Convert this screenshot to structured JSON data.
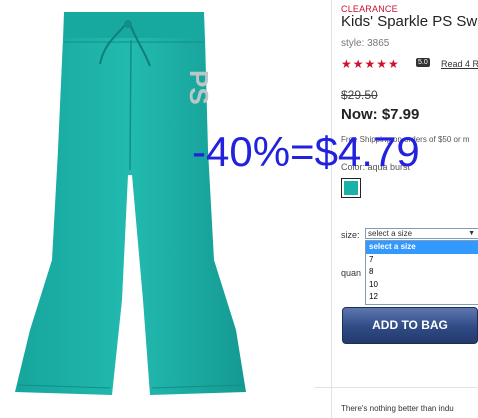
{
  "product": {
    "badge": "CLEARANCE",
    "title": "Kids' Sparkle PS Sw",
    "style": "style: 3865",
    "stars": "★★★★★",
    "rating": "5.0",
    "reviews_link": "Read 4 R",
    "old_price": "$29.50",
    "now_price": "Now: $7.99",
    "shipping": "Free Shipping on orders of $50 or m",
    "color_label": "Color: aqua burst",
    "swatch_color": "#1ab2a8",
    "size_label": "size:",
    "size_select": "select a size",
    "size_options": [
      "select a size",
      "7",
      "8",
      "10",
      "12"
    ],
    "qty_label": "quan",
    "add_to_bag": "ADD TO BAG",
    "description": "There's nothing better than indu"
  },
  "overlay": {
    "text": "-40%=$4.79",
    "color": "#2222dd"
  },
  "image": {
    "logo_text": "PS",
    "pants_color": "#1fb3aa"
  }
}
